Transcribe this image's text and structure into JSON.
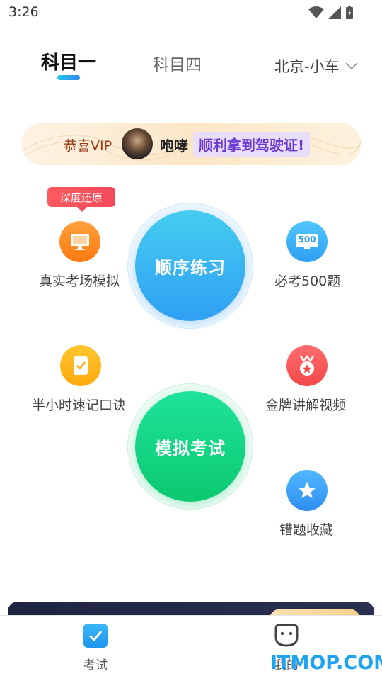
{
  "status_bar": {
    "time": "3:26"
  },
  "header": {
    "tabs": [
      {
        "label": "科目一",
        "active": true
      },
      {
        "label": "科目四",
        "active": false
      }
    ],
    "city": "北京-小车"
  },
  "vip_banner": {
    "prefix": "恭喜VIP",
    "user": "咆哮",
    "message": "顺利拿到驾驶证!"
  },
  "features": {
    "exam_sim": {
      "label": "真实考场模拟",
      "badge": "深度还原",
      "icon": "monitor-icon"
    },
    "must_500": {
      "label": "必考500题",
      "icon_text": "500",
      "icon": "screen-500-icon"
    },
    "mnemonic": {
      "label": "半小时速记口诀",
      "icon": "notebook-check-icon"
    },
    "gold_video": {
      "label": "金牌讲解视频",
      "icon": "medal-icon"
    },
    "mistakes": {
      "label": "错题收藏",
      "icon": "star-icon"
    }
  },
  "main_buttons": {
    "sequential": {
      "label": "顺序练习"
    },
    "mock_exam": {
      "label": "模拟考试"
    }
  },
  "bottom_nav": {
    "items": [
      {
        "label": "考试",
        "icon": "exam-check-icon",
        "active": true
      },
      {
        "label": "我的",
        "icon": "smiley-face-icon",
        "active": false
      }
    ]
  },
  "watermark": "ITMOP.COM",
  "colors": {
    "blue_accent": "#2f9ff3",
    "green_accent": "#10cf7a",
    "vip_purple": "#6b3ad1",
    "badge_red": "#f24a5a"
  }
}
